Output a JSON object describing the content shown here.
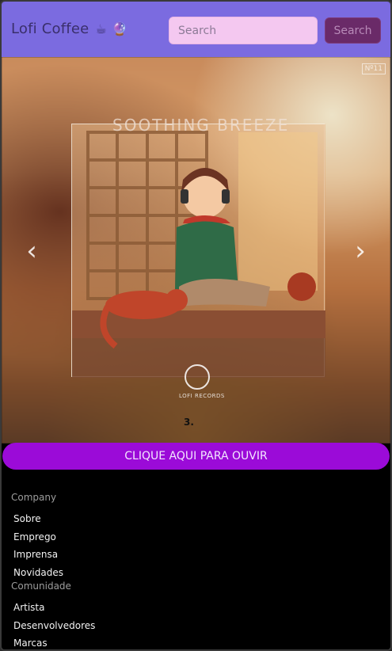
{
  "navbar": {
    "brand": "Lofi Coffee",
    "brand_icon_1": "☕",
    "brand_icon_2": "🔮",
    "search_placeholder": "Search",
    "search_button": "Search"
  },
  "carousel": {
    "art_title": "SOOTHING  BREEZE",
    "badge": "Nº11",
    "logo_text": "LOFI RECORDS",
    "indicator": "3.",
    "prev_glyph": "‹",
    "next_glyph": "›"
  },
  "cta": {
    "label": "CLIQUE AQUI PARA OUVIR"
  },
  "footer": {
    "company_heading": "Company",
    "company_links": [
      "Sobre",
      "Emprego",
      "Imprensa",
      "Novidades"
    ],
    "community_heading": "Comunidade",
    "community_links": [
      "Artista",
      "Desenvolvedores",
      "Marcas"
    ]
  },
  "colors": {
    "navbar": "#7b6be0",
    "search_input": "#f4c8f0",
    "search_button": "#6a2a68",
    "cta": "#9b0bd8",
    "footer": "#000000"
  }
}
